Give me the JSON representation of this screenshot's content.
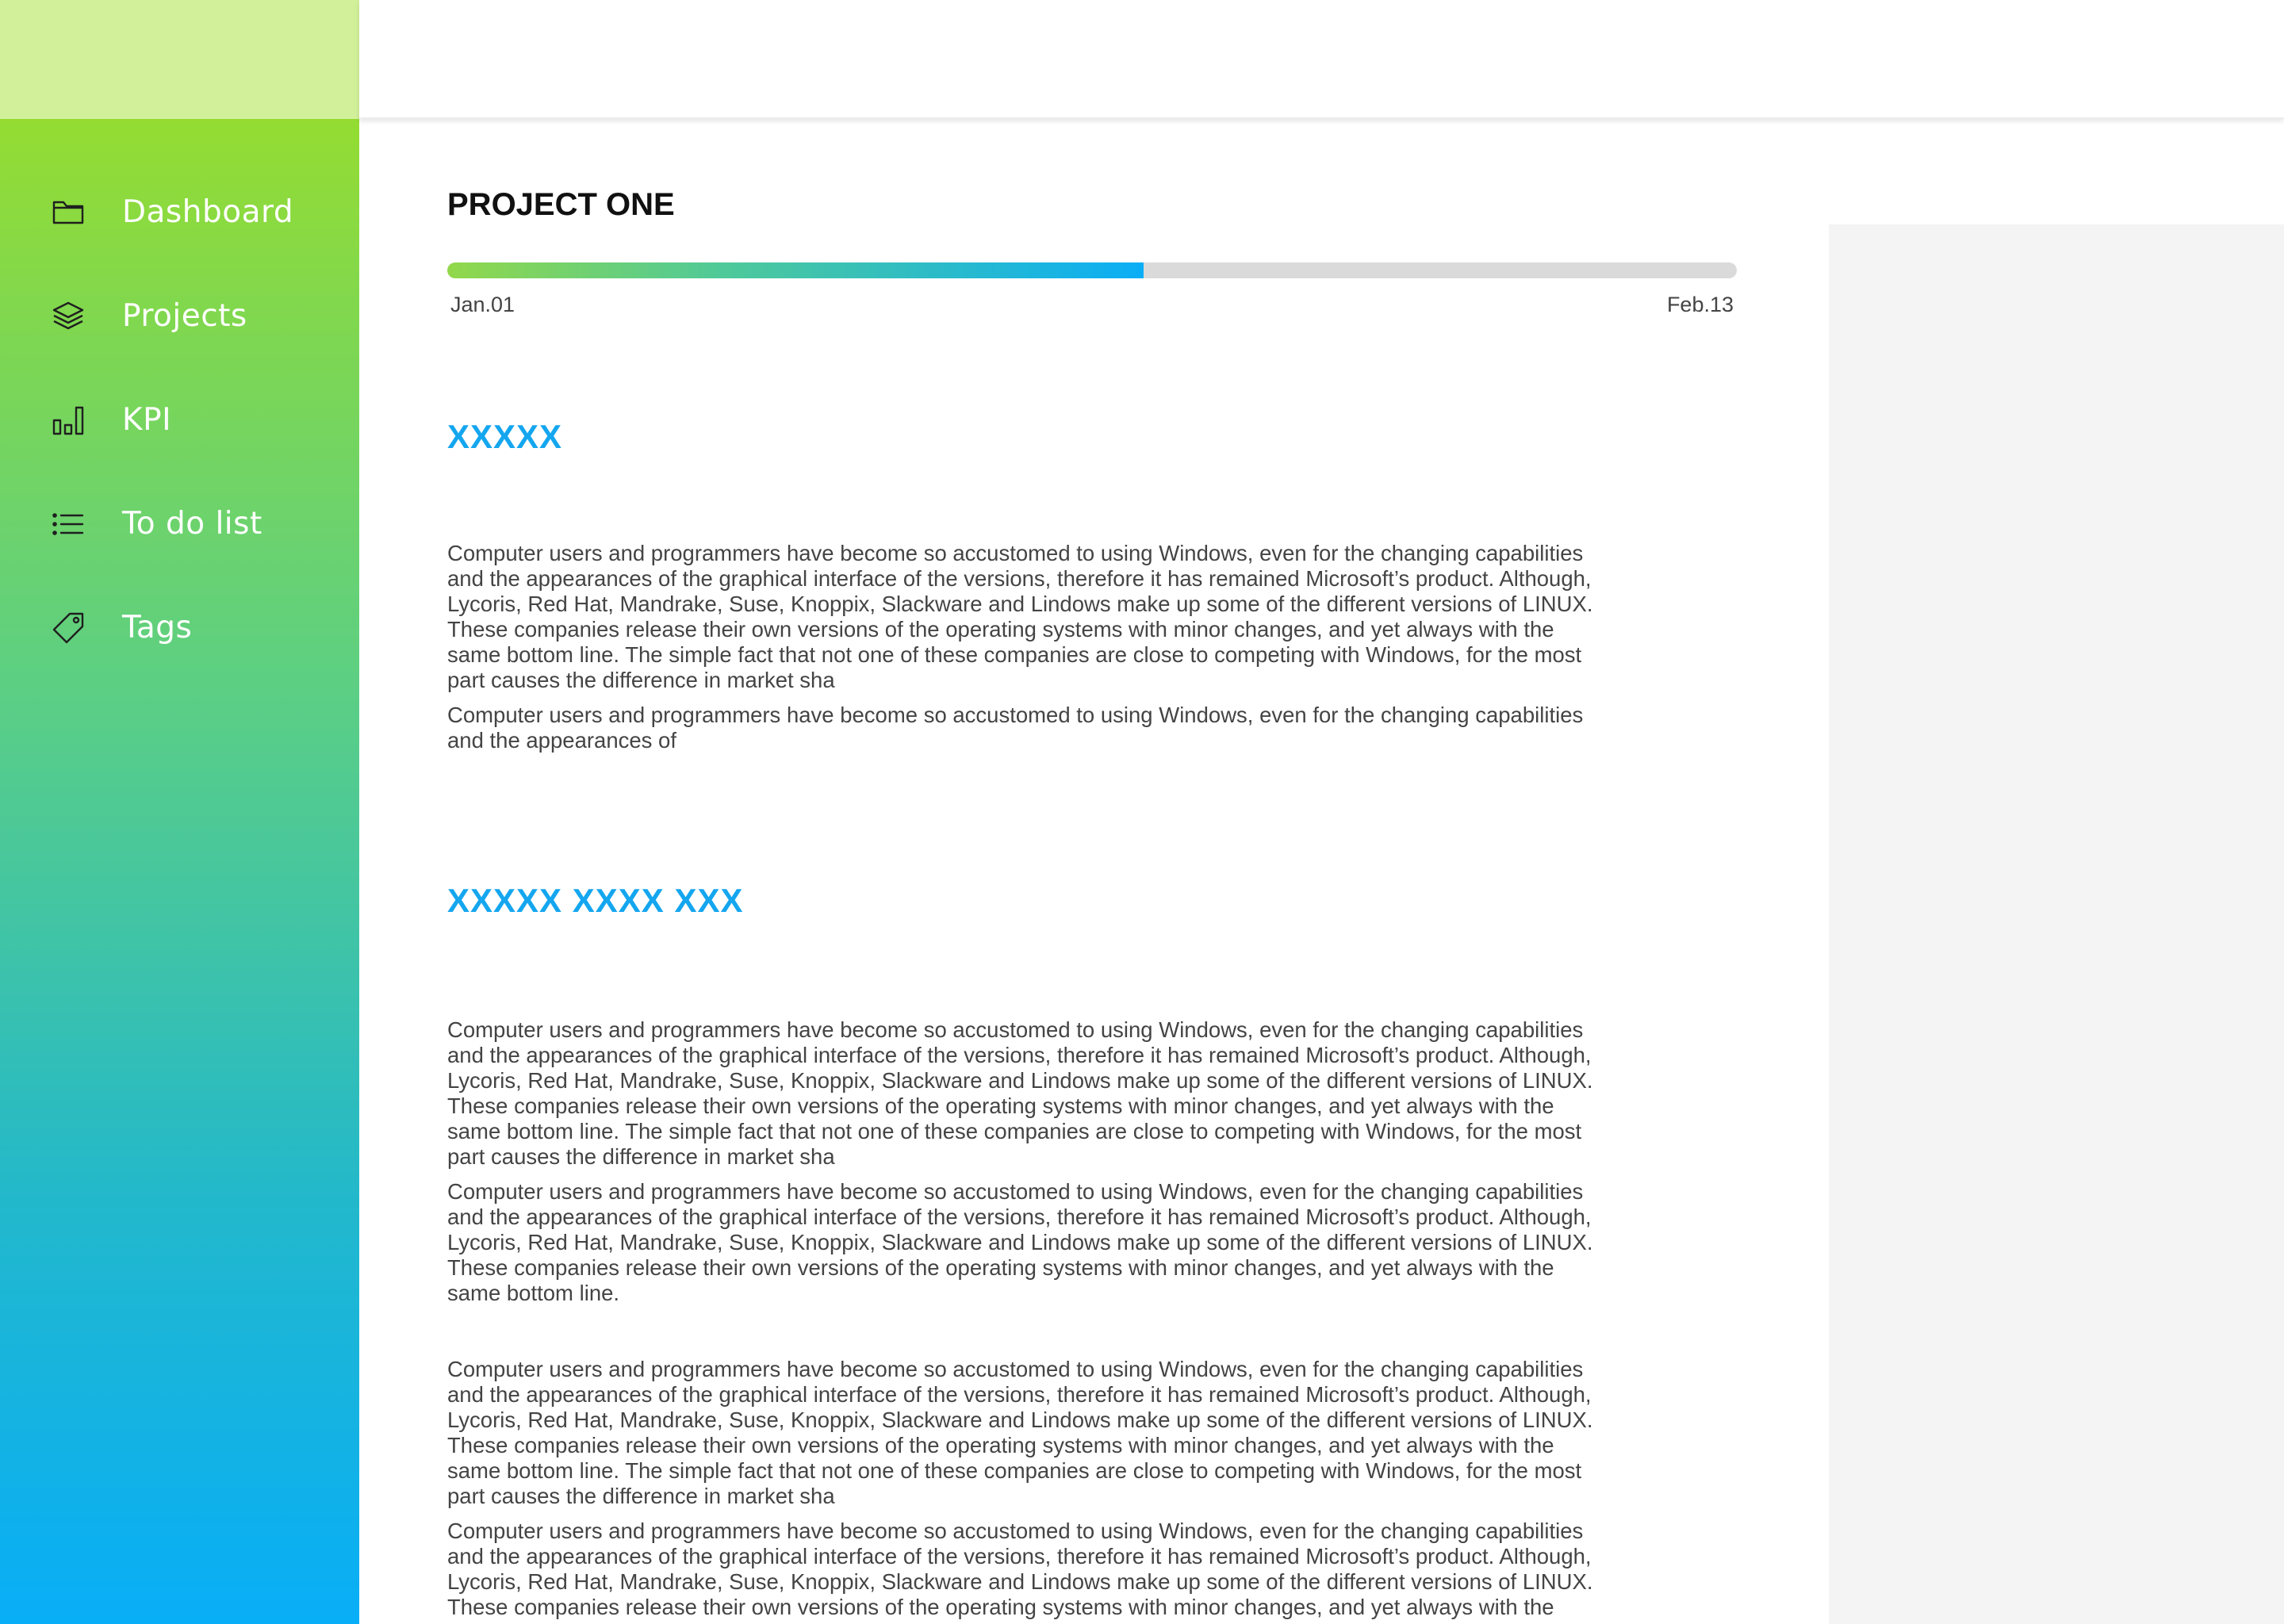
{
  "sidebar": {
    "items": [
      {
        "label": "Dashboard",
        "icon": "folder-icon"
      },
      {
        "label": "Projects",
        "icon": "layers-icon"
      },
      {
        "label": "KPI",
        "icon": "bar-chart-icon"
      },
      {
        "label": "To do list",
        "icon": "list-icon"
      },
      {
        "label": "Tags",
        "icon": "tag-icon"
      }
    ],
    "colors": {
      "top": "#94dc32",
      "bottom": "#08aef7",
      "logo_area": "#d2f09a"
    }
  },
  "project": {
    "title": "PROJECT ONE",
    "progress": 0.54,
    "start_date": "Jan.01",
    "end_date": "Feb.13"
  },
  "sections": [
    {
      "heading": "XXXXX",
      "paragraphs": [
        "Computer users and programmers have become so accustomed to using Windows, even for the changing capabilities and the appearances of the graphical interface of the versions, therefore it has remained Microsoft’s product. Although, Lycoris, Red Hat, Mandrake, Suse, Knoppix, Slackware and Lindows make up some of the different versions of LINUX. These companies release their own versions of the operating systems with minor changes, and yet always with the same bottom line. The simple fact that not one of these companies are close to competing with Windows, for the most part causes the difference in market sha",
        "Computer users and programmers have become so accustomed to using Windows, even for the changing capabilities and the appearances of"
      ]
    },
    {
      "heading": "XXXXX XXXX XXX",
      "paragraphs": [
        "Computer users and programmers have become so accustomed to using Windows, even for the changing capabilities and the appearances of the graphical interface of the versions, therefore it has remained Microsoft’s product. Although, Lycoris, Red Hat, Mandrake, Suse, Knoppix, Slackware and Lindows make up some of the different versions of LINUX. These companies release their own versions of the operating systems with minor changes, and yet always with the same bottom line. The simple fact that not one of these companies are close to competing with Windows, for the most part causes the difference in market sha",
        "Computer users and programmers have become so accustomed to using Windows, even for the changing capabilities and the appearances of the graphical interface of the versions, therefore it has remained Microsoft’s product. Although, Lycoris, Red Hat, Mandrake, Suse, Knoppix, Slackware and Lindows make up some of the different versions of LINUX. These companies release their own versions of the operating systems with minor changes, and yet always with the same bottom line.",
        "Computer users and programmers have become so accustomed to using Windows, even for the changing capabilities and the appearances of the graphical interface of the versions, therefore it has remained Microsoft’s product. Although, Lycoris, Red Hat, Mandrake, Suse, Knoppix, Slackware and Lindows make up some of the different versions of LINUX. These companies release their own versions of the operating systems with minor changes, and yet always with the same bottom line. The simple fact that not one of these companies are close to competing with Windows, for the most part causes the difference in market sha",
        "Computer users and programmers have become so accustomed to using Windows, even for the changing capabilities and the appearances of the graphical interface of the versions, therefore it has remained Microsoft’s product. Although, Lycoris, Red Hat, Mandrake, Suse, Knoppix, Slackware and Lindows make up some of the different versions of LINUX. These companies release their own versions of the operating systems with minor changes, and yet always with the same bottom line."
      ]
    }
  ],
  "colors": {
    "accent": "#14a6ef",
    "progress_start": "#92d84a",
    "progress_end": "#0aaef6",
    "progress_track": "#dadada",
    "body_text": "#444444",
    "right_panel": "#f4f4f4"
  }
}
